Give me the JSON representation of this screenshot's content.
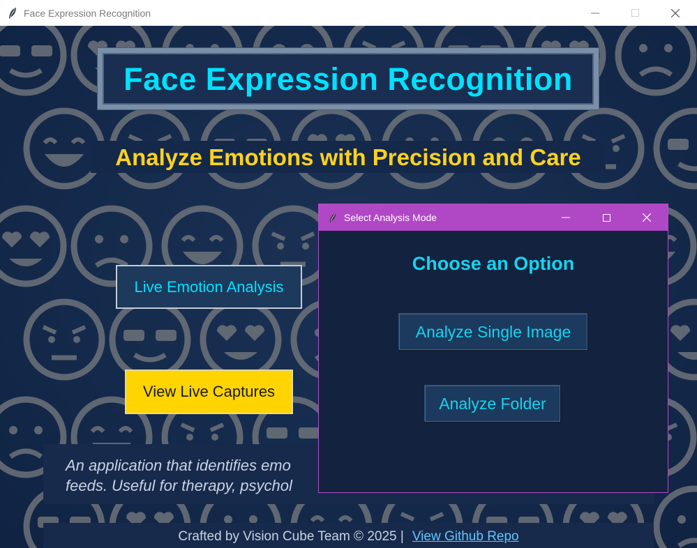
{
  "window": {
    "title": "Face Expression Recognition",
    "controls": [
      "minimize-icon",
      "maximize-icon",
      "close-icon"
    ]
  },
  "header": {
    "title": "Face Expression Recognition",
    "subtitle": "Analyze Emotions with Precision and Care"
  },
  "buttons": {
    "live_analysis": "Live Emotion Analysis",
    "view_captures": "View Live Captures"
  },
  "description": {
    "line1": "An application that identifies emo",
    "line2": "feeds. Useful for therapy, psychol"
  },
  "footer": {
    "credit": "Crafted by Vision Cube Team © 2025 |",
    "link": "View Github Repo"
  },
  "dialog": {
    "title": "Select Analysis Mode",
    "heading": "Choose an Option",
    "single_image_label": "Analyze Single Image",
    "folder_label": "Analyze Folder",
    "controls": [
      "minimize-icon",
      "maximize-icon",
      "close-icon"
    ]
  },
  "colors": {
    "accent_cyan": "#00e1ff",
    "accent_yellow": "#ffd21e",
    "background_navy": "#152a4c",
    "dialog_titlebar": "#b048c6",
    "emoji_gray": "#8a8a8a"
  }
}
